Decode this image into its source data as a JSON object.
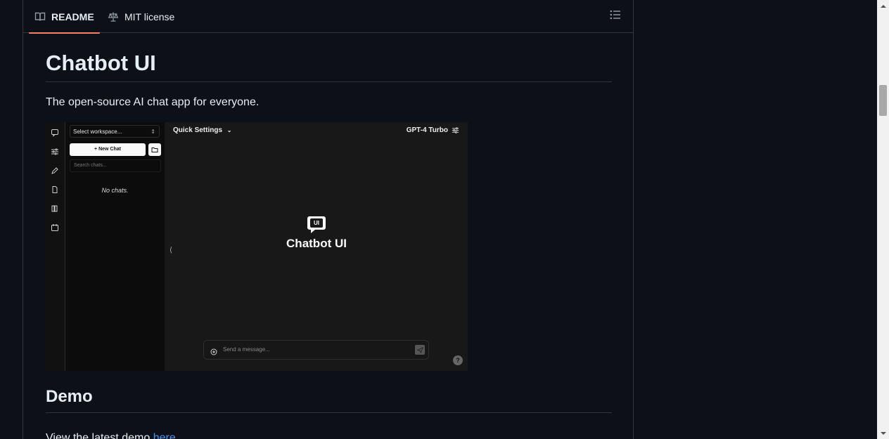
{
  "tabs": {
    "readme": "README",
    "license": "MIT license"
  },
  "readme": {
    "title": "Chatbot UI",
    "tagline": "The open-source AI chat app for everyone.",
    "demo_heading": "Demo",
    "demo_text": "View the latest demo ",
    "demo_link": "here"
  },
  "screenshot": {
    "workspace_select": "Select workspace...",
    "new_chat": "+ New Chat",
    "search_placeholder": "Search chats...",
    "no_chats": "No chats.",
    "quick_settings": "Quick Settings",
    "model": "GPT-4 Turbo",
    "logo_text": "UI",
    "brand": "Chatbot UI",
    "message_placeholder": "Send a message...",
    "help": "?"
  },
  "colors": {
    "background": "#0d1117",
    "border": "#30363d",
    "active_tab_underline": "#f78166",
    "link": "#4493f8"
  }
}
